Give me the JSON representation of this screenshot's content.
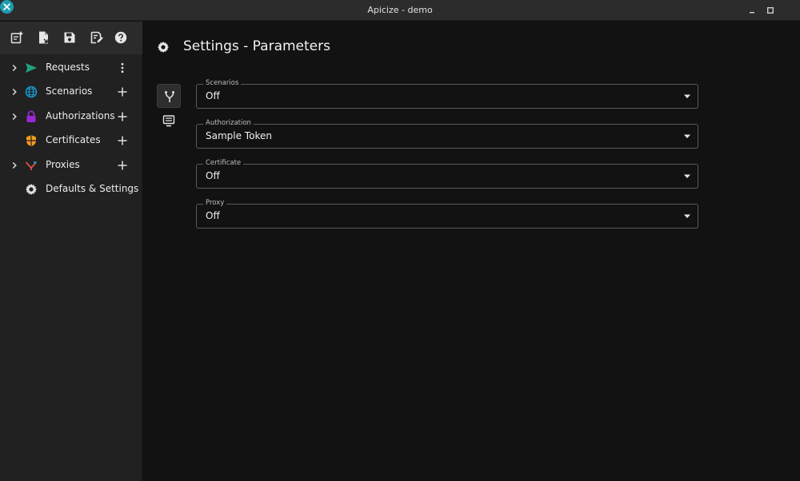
{
  "window": {
    "title": "Apicize - demo"
  },
  "toolbar": {
    "buttons": [
      {
        "icon": "new-workbook-icon"
      },
      {
        "icon": "open-file-icon"
      },
      {
        "icon": "save-icon"
      },
      {
        "icon": "save-as-icon"
      },
      {
        "icon": "help-icon"
      }
    ]
  },
  "sidebar": {
    "items": [
      {
        "label": "Requests",
        "icon": "send-icon",
        "color": "#1fa37c",
        "expandable": true,
        "action": "more-vertical-icon"
      },
      {
        "label": "Scenarios",
        "icon": "globe-icon",
        "color": "#1a94c9",
        "expandable": true,
        "action": "add-icon"
      },
      {
        "label": "Authorizations",
        "icon": "lock-icon",
        "color": "#9b27d6",
        "expandable": true,
        "action": "add-icon"
      },
      {
        "label": "Certificates",
        "icon": "shield-icon",
        "color": "#f39a1b",
        "expandable": false,
        "action": "add-icon"
      },
      {
        "label": "Proxies",
        "icon": "proxy-icon",
        "color": "#d9534f",
        "expandable": true,
        "action": "add-icon"
      },
      {
        "label": "Defaults & Settings",
        "icon": "gear-icon",
        "color": "#e0e0e0",
        "expandable": false,
        "action": ""
      }
    ]
  },
  "main": {
    "title": "Settings - Parameters",
    "tabs": [
      {
        "name": "parameters",
        "icon": "fork-icon",
        "active": true
      },
      {
        "name": "display",
        "icon": "display-icon",
        "active": false
      }
    ],
    "fields": [
      {
        "label": "Scenarios",
        "value": "Off"
      },
      {
        "label": "Authorization",
        "value": "Sample Token"
      },
      {
        "label": "Certificate",
        "value": "Off"
      },
      {
        "label": "Proxy",
        "value": "Off"
      }
    ]
  }
}
